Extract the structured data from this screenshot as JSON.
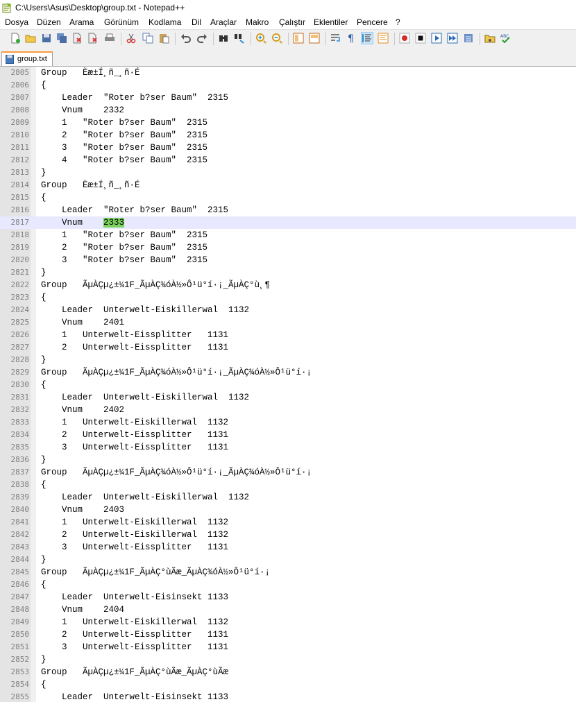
{
  "window": {
    "title": "C:\\Users\\Asus\\Desktop\\group.txt - Notepad++"
  },
  "menu": [
    "Dosya",
    "Düzen",
    "Arama",
    "Görünüm",
    "Kodlama",
    "Dil",
    "Araçlar",
    "Makro",
    "Çalıştır",
    "Eklentiler",
    "Pencere",
    "?"
  ],
  "toolbar": {
    "icons": [
      "new-file-icon",
      "open-file-icon",
      "save-icon",
      "save-all-icon",
      "close-icon",
      "close-all-icon",
      "print-icon",
      "cut-icon",
      "copy-icon",
      "paste-icon",
      "undo-icon",
      "redo-icon",
      "find-icon",
      "replace-icon",
      "zoom-in-icon",
      "zoom-out-icon",
      "sync-vertical-icon",
      "sync-horizontal-icon",
      "word-wrap-icon",
      "show-all-chars-icon",
      "indent-guide-icon",
      "doc-map-icon",
      "record-macro-icon",
      "stop-macro-icon",
      "play-macro-icon",
      "run-macro-multiple-icon",
      "save-macro-icon",
      "open-folder-icon",
      "spell-check-icon"
    ]
  },
  "tab": {
    "label": "group.txt"
  },
  "editor": {
    "current_line": "2817",
    "selected_text": "2333",
    "lines": [
      {
        "num": "2805",
        "text": "Group   Èæ±Í¸ñ_¸ñ·É"
      },
      {
        "num": "2806",
        "text": "{"
      },
      {
        "num": "2807",
        "text": "    Leader  \"Roter b?ser Baum\"  2315"
      },
      {
        "num": "2808",
        "text": "    Vnum    2332"
      },
      {
        "num": "2809",
        "text": "    1   \"Roter b?ser Baum\"  2315"
      },
      {
        "num": "2810",
        "text": "    2   \"Roter b?ser Baum\"  2315"
      },
      {
        "num": "2811",
        "text": "    3   \"Roter b?ser Baum\"  2315"
      },
      {
        "num": "2812",
        "text": "    4   \"Roter b?ser Baum\"  2315"
      },
      {
        "num": "2813",
        "text": "}"
      },
      {
        "num": "2814",
        "text": "Group   Èæ±Í¸ñ_¸ñ·É"
      },
      {
        "num": "2815",
        "text": "{"
      },
      {
        "num": "2816",
        "text": "    Leader  \"Roter b?ser Baum\"  2315"
      },
      {
        "num": "2817",
        "text": "    Vnum    2333"
      },
      {
        "num": "2818",
        "text": "    1   \"Roter b?ser Baum\"  2315"
      },
      {
        "num": "2819",
        "text": "    2   \"Roter b?ser Baum\"  2315"
      },
      {
        "num": "2820",
        "text": "    3   \"Roter b?ser Baum\"  2315"
      },
      {
        "num": "2821",
        "text": "}"
      },
      {
        "num": "2822",
        "text": "Group   ÃµÀÇµ¿±¼1F_ÃµÀÇ¾óÀ½»Ô¹ü°í·¡_ÃµÀÇ°ù¸¶"
      },
      {
        "num": "2823",
        "text": "{"
      },
      {
        "num": "2824",
        "text": "    Leader  Unterwelt-Eiskillerwal  1132"
      },
      {
        "num": "2825",
        "text": "    Vnum    2401"
      },
      {
        "num": "2826",
        "text": "    1   Unterwelt-Eissplitter   1131"
      },
      {
        "num": "2827",
        "text": "    2   Unterwelt-Eissplitter   1131"
      },
      {
        "num": "2828",
        "text": "}"
      },
      {
        "num": "2829",
        "text": "Group   ÃµÀÇµ¿±¼1F_ÃµÀÇ¾óÀ½»Ô¹ü°í·¡_ÃµÀÇ¾óÀ½»Ô¹ü°í·¡"
      },
      {
        "num": "2830",
        "text": "{"
      },
      {
        "num": "2831",
        "text": "    Leader  Unterwelt-Eiskillerwal  1132"
      },
      {
        "num": "2832",
        "text": "    Vnum    2402"
      },
      {
        "num": "2833",
        "text": "    1   Unterwelt-Eiskillerwal  1132"
      },
      {
        "num": "2834",
        "text": "    2   Unterwelt-Eissplitter   1131"
      },
      {
        "num": "2835",
        "text": "    3   Unterwelt-Eissplitter   1131"
      },
      {
        "num": "2836",
        "text": "}"
      },
      {
        "num": "2837",
        "text": "Group   ÃµÀÇµ¿±¼1F_ÃµÀÇ¾óÀ½»Ô¹ü°í·¡_ÃµÀÇ¾óÀ½»Ô¹ü°í·¡"
      },
      {
        "num": "2838",
        "text": "{"
      },
      {
        "num": "2839",
        "text": "    Leader  Unterwelt-Eiskillerwal  1132"
      },
      {
        "num": "2840",
        "text": "    Vnum    2403"
      },
      {
        "num": "2841",
        "text": "    1   Unterwelt-Eiskillerwal  1132"
      },
      {
        "num": "2842",
        "text": "    2   Unterwelt-Eiskillerwal  1132"
      },
      {
        "num": "2843",
        "text": "    3   Unterwelt-Eissplitter   1131"
      },
      {
        "num": "2844",
        "text": "}"
      },
      {
        "num": "2845",
        "text": "Group   ÃµÀÇµ¿±¼1F_ÃµÀÇ°ùÃæ_ÃµÀÇ¾óÀ½»Ô¹ü°í·¡"
      },
      {
        "num": "2846",
        "text": "{"
      },
      {
        "num": "2847",
        "text": "    Leader  Unterwelt-Eisinsekt 1133"
      },
      {
        "num": "2848",
        "text": "    Vnum    2404"
      },
      {
        "num": "2849",
        "text": "    1   Unterwelt-Eiskillerwal  1132"
      },
      {
        "num": "2850",
        "text": "    2   Unterwelt-Eissplitter   1131"
      },
      {
        "num": "2851",
        "text": "    3   Unterwelt-Eissplitter   1131"
      },
      {
        "num": "2852",
        "text": "}"
      },
      {
        "num": "2853",
        "text": "Group   ÃµÀÇµ¿±¼1F_ÃµÀÇ°ùÃæ_ÃµÀÇ°ùÃæ"
      },
      {
        "num": "2854",
        "text": "{"
      },
      {
        "num": "2855",
        "text": "    Leader  Unterwelt-Eisinsekt 1133"
      }
    ]
  }
}
